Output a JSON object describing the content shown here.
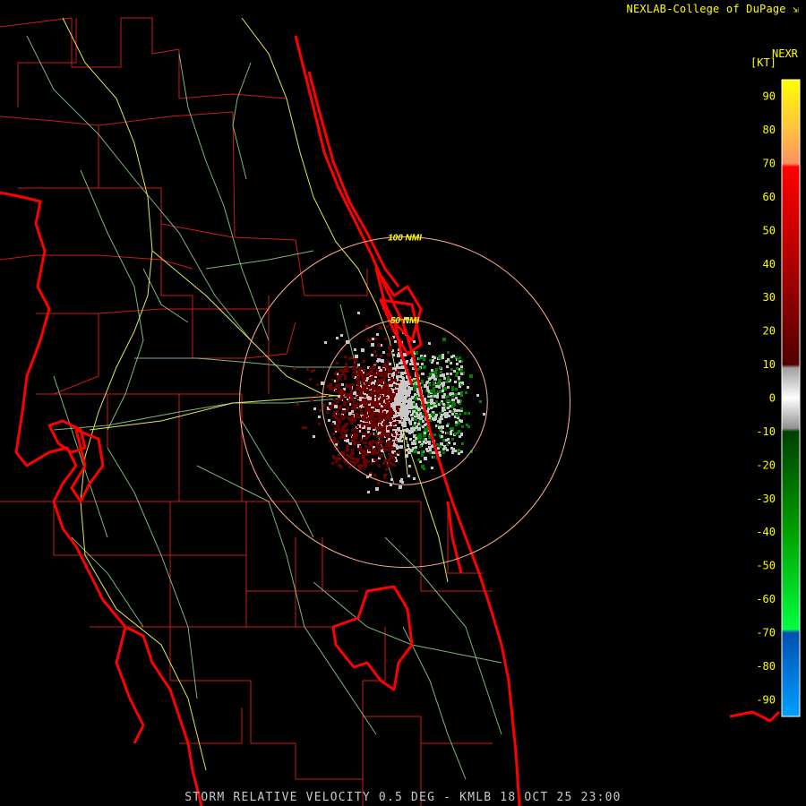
{
  "header": {
    "credit": "NEXLAB-College of DuPage",
    "credit_icon": "cursor-arrow-icon",
    "product_code": "NEXR",
    "unit_label": "[KT]"
  },
  "range_rings": [
    {
      "label": "100 NMI",
      "radius_nmi": 100
    },
    {
      "label": "50 NMI",
      "radius_nmi": 50
    }
  ],
  "legend": {
    "unit": "KT",
    "tick_labels": [
      "90",
      "80",
      "70",
      "60",
      "50",
      "40",
      "30",
      "20",
      "10",
      "0",
      "-10",
      "-20",
      "-30",
      "-40",
      "-50",
      "-60",
      "-70",
      "-80",
      "-90"
    ],
    "color_stops": [
      {
        "value": 95,
        "color": "#ffff00"
      },
      {
        "value": 80,
        "color": "#ffc040"
      },
      {
        "value": 70,
        "color": "#ff9060"
      },
      {
        "value": 69,
        "color": "#ff0000"
      },
      {
        "value": 40,
        "color": "#b00000"
      },
      {
        "value": 10,
        "color": "#500000"
      },
      {
        "value": 9,
        "color": "#a0a0a0"
      },
      {
        "value": 0,
        "color": "#ffffff"
      },
      {
        "value": -9,
        "color": "#909090"
      },
      {
        "value": -10,
        "color": "#004000"
      },
      {
        "value": -40,
        "color": "#00a000"
      },
      {
        "value": -69,
        "color": "#00ff40"
      },
      {
        "value": -70,
        "color": "#0050b0"
      },
      {
        "value": -95,
        "color": "#00a0ff"
      }
    ]
  },
  "colors": {
    "coastline": "#ff0000",
    "county_lines": "#cc1a1a",
    "roads": "#8fd68f",
    "highways": "#e6e64d",
    "range_ring": "#ffb090",
    "inbound_velocity": "#008000",
    "outbound_velocity": "#6b0000",
    "near_zero_velocity": "#c8c8c8"
  },
  "footer": {
    "caption": "STORM RELATIVE VELOCITY 0.5 DEG - KMLB 18 OCT 25 23:00"
  }
}
